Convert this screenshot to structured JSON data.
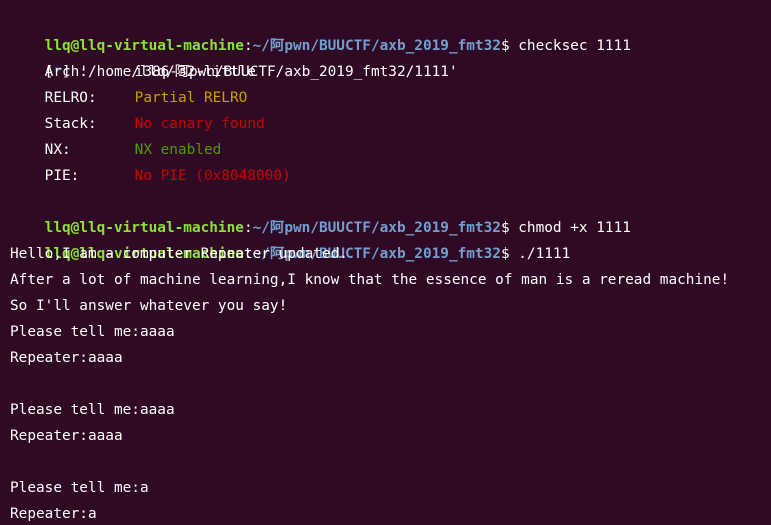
{
  "prompt": {
    "user": "llq@llq-virtual-machine",
    "sep": ":",
    "path": "~/阿pwn/BUUCTF/axb_2019_fmt32",
    "dollar": "$ "
  },
  "commands": {
    "checksec": "checksec 1111",
    "chmod": "chmod +x 1111",
    "run": "./1111"
  },
  "checksec": {
    "header_open": "[",
    "header_star": "*",
    "header_close": "] ",
    "header_path": "'/home/llq/阿pwn/BUUCTF/axb_2019_fmt32/1111'",
    "rows": [
      {
        "key": "Arch:",
        "value": "i386-32-little",
        "color": "#ffffff"
      },
      {
        "key": "RELRO:",
        "value": "Partial RELRO",
        "color": "#c4a000"
      },
      {
        "key": "Stack:",
        "value": "No canary found",
        "color": "#cc0000"
      },
      {
        "key": "NX:",
        "value": "NX enabled",
        "color": "#4e9a06"
      },
      {
        "key": "PIE:",
        "value": "No PIE (0x8048000)",
        "color": "#cc0000"
      }
    ]
  },
  "output": {
    "line1": "Hello,I am a computer Repeater updated.",
    "line2": "After a lot of machine learning,I know that the essence of man is a reread machine!",
    "line3": "So I'll answer whatever you say!",
    "line4": "Please tell me:aaaa",
    "line5": "Repeater:aaaa",
    "line6": "",
    "line7": "Please tell me:aaaa",
    "line8": "Repeater:aaaa",
    "line9": "",
    "line10": "Please tell me:a",
    "line11": "Repeater:a"
  },
  "colors": {
    "background": "#300a24",
    "prompt_user": "#8ae234",
    "prompt_path": "#729fcf"
  }
}
